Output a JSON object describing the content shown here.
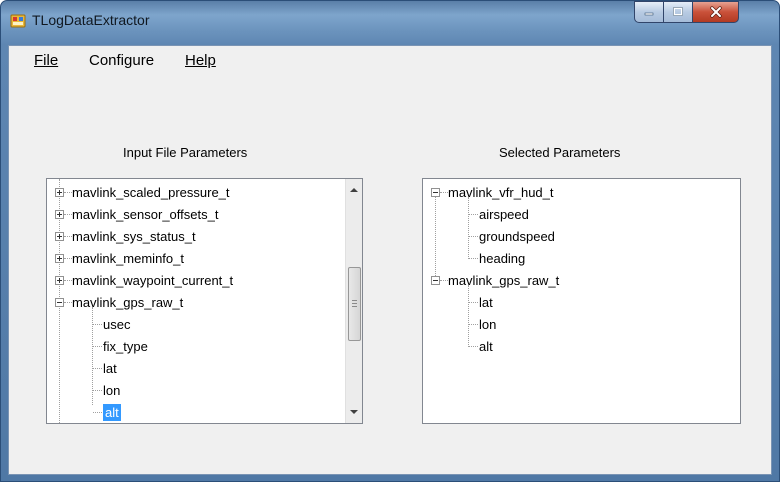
{
  "window": {
    "title": "TLogDataExtractor",
    "icon": "app-icon",
    "controls": [
      "minimize-icon",
      "maximize-icon",
      "close-icon"
    ]
  },
  "menu": {
    "items": [
      {
        "label": "File"
      },
      {
        "label": "Configure"
      },
      {
        "label": "Help"
      }
    ]
  },
  "input_panel": {
    "label": "Input File Parameters",
    "nodes": [
      {
        "label": "mavlink_scaled_pressure_t",
        "state": "collapsed"
      },
      {
        "label": "mavlink_sensor_offsets_t",
        "state": "collapsed"
      },
      {
        "label": "mavlink_sys_status_t",
        "state": "collapsed"
      },
      {
        "label": "mavlink_meminfo_t",
        "state": "collapsed"
      },
      {
        "label": "mavlink_waypoint_current_t",
        "state": "collapsed"
      },
      {
        "label": "mavlink_gps_raw_t",
        "state": "expanded",
        "children": [
          {
            "label": "usec"
          },
          {
            "label": "fix_type"
          },
          {
            "label": "lat"
          },
          {
            "label": "lon"
          },
          {
            "label": "alt",
            "selected": true
          }
        ]
      }
    ]
  },
  "selected_panel": {
    "label": "Selected Parameters",
    "nodes": [
      {
        "label": "mavlink_vfr_hud_t",
        "state": "expanded",
        "children": [
          {
            "label": "airspeed"
          },
          {
            "label": "groundspeed"
          },
          {
            "label": "heading"
          }
        ]
      },
      {
        "label": "mavlink_gps_raw_t",
        "state": "expanded",
        "children": [
          {
            "label": "lat"
          },
          {
            "label": "lon"
          },
          {
            "label": "alt"
          }
        ]
      }
    ]
  },
  "colors": {
    "selection": "#3399ff",
    "client_bg": "#f0f0f0",
    "close_button": "#c9513a"
  }
}
